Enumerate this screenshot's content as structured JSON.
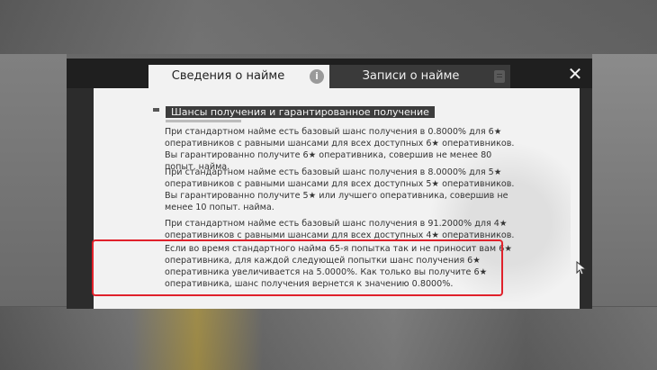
{
  "tabs": [
    {
      "label": "Сведения о найме",
      "active": true,
      "icon": "info-icon"
    },
    {
      "label": "Записи о найме",
      "active": false,
      "icon": "document-icon"
    }
  ],
  "close_icon": "close-icon",
  "section": {
    "title": "Шансы получения и гарантированное получение"
  },
  "paragraphs": [
    "При стандартном найме есть базовый шанс получения в 0.8000% для 6★ оперативников с равными шансами для всех доступных 6★ оперативников. Вы гарантированно получите 6★ оперативника, совершив не менее 80 попыт. найма.",
    "При стандартном найме есть базовый шанс получения в 8.0000% для 5★ оперативников с равными шансами для всех доступных 5★ оперативников. Вы гарантированно получите 5★ или лучшего оперативника, совершив не менее 10 попыт. найма.",
    "При стандартном найме есть базовый шанс получения в 91.2000% для 4★ оперативников с равными шансами для всех доступных 4★ оперативников.",
    "Если во время стандартного найма 65-я попытка так и не приносит вам 6★ оперативника, для каждой следующей попытки шанс получения 6★ оперативника увеличивается на 5.0000%. Как только вы получите 6★ оперативника, шанс получения вернется к значению 0.8000%."
  ],
  "highlight_color": "#e0212b"
}
